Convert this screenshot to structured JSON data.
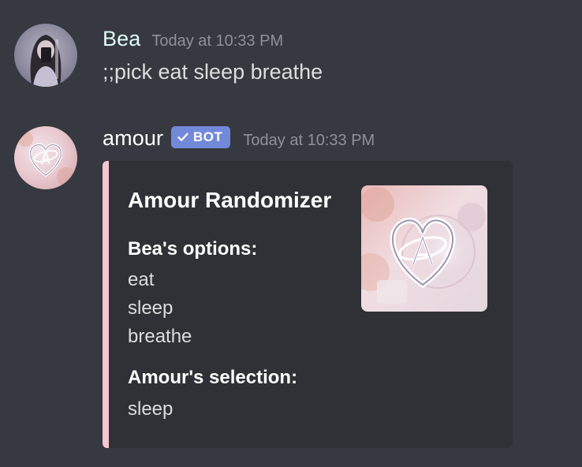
{
  "messages": [
    {
      "author": "Bea",
      "author_color": "#dffaf6",
      "timestamp": "Today at 10:33 PM",
      "content": ";;pick eat sleep breathe",
      "avatar_icon": "user-avatar"
    },
    {
      "author": "amour",
      "author_color": "#ffffff",
      "timestamp": "Today at 10:33 PM",
      "bot_tag": "BOT",
      "avatar_icon": "heart-logo-avatar",
      "embed": {
        "accent_color": "#f7c6d0",
        "title": "Amour Randomizer",
        "fields": [
          {
            "name": "Bea's options:",
            "values": [
              "eat",
              "sleep",
              "breathe"
            ]
          },
          {
            "name": "Amour's selection:",
            "values": [
              "sleep"
            ]
          }
        ],
        "thumbnail_icon": "heart-logo-thumbnail"
      }
    }
  ],
  "colors": {
    "background": "#36393f",
    "embed_background": "#2f3136",
    "timestamp": "#8e9297",
    "text": "#dcddde",
    "bot_tag": "#7289da"
  }
}
